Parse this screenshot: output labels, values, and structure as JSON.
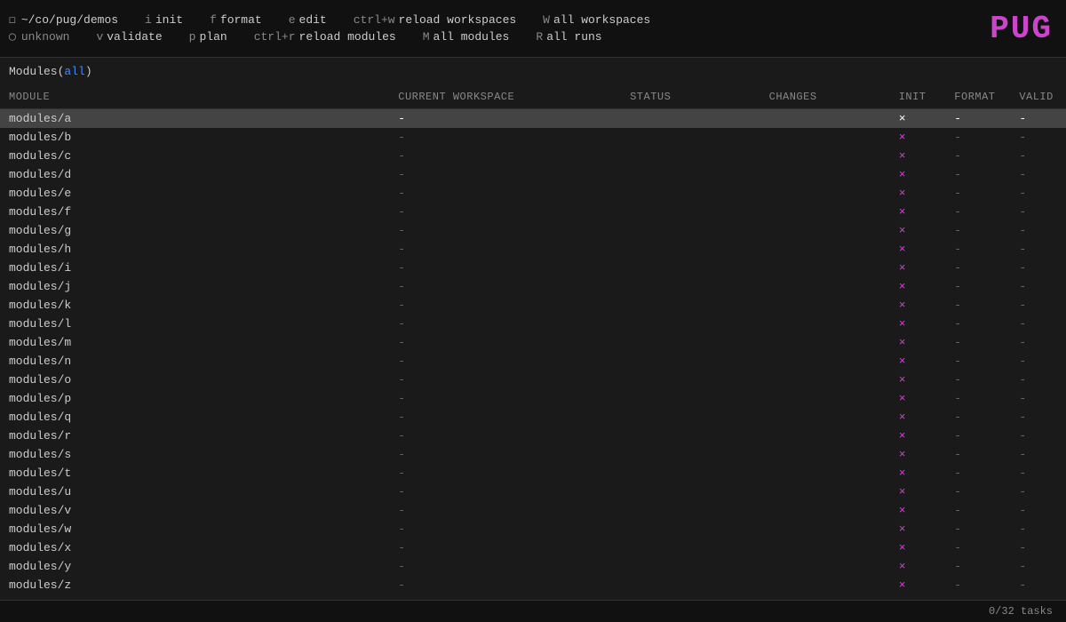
{
  "toolbar": {
    "path": "~/co/pug/demos",
    "path_icon": "⊙",
    "unknown_label": "unknown",
    "shortcuts": [
      {
        "key": "i",
        "label": "init"
      },
      {
        "key": "f",
        "label": "format"
      },
      {
        "key": "e",
        "label": "edit"
      },
      {
        "key": "ctrl+w",
        "label": "reload workspaces"
      },
      {
        "key": "W",
        "label": "all workspaces"
      }
    ],
    "shortcuts2": [
      {
        "key": "v",
        "label": "validate"
      },
      {
        "key": "p",
        "label": "plan"
      },
      {
        "key": "ctrl+r",
        "label": "reload modules"
      },
      {
        "key": "M",
        "label": "all modules"
      },
      {
        "key": "R",
        "label": "all runs"
      }
    ]
  },
  "logo": "PUG",
  "modules_title": "Modules",
  "modules_filter": "all",
  "table": {
    "headers": [
      "MODULE",
      "CURRENT WORKSPACE",
      "STATUS",
      "CHANGES",
      "INIT",
      "FORMAT",
      "VALID"
    ],
    "rows": [
      {
        "module": "modules/a",
        "workspace": "-",
        "status": "",
        "changes": "",
        "init": "×",
        "format": "-",
        "valid": "-",
        "selected": true
      },
      {
        "module": "modules/b",
        "workspace": "-",
        "status": "",
        "changes": "",
        "init": "×",
        "format": "-",
        "valid": "-"
      },
      {
        "module": "modules/c",
        "workspace": "-",
        "status": "",
        "changes": "",
        "init": "×",
        "format": "-",
        "valid": "-"
      },
      {
        "module": "modules/d",
        "workspace": "-",
        "status": "",
        "changes": "",
        "init": "×",
        "format": "-",
        "valid": "-"
      },
      {
        "module": "modules/e",
        "workspace": "-",
        "status": "",
        "changes": "",
        "init": "×",
        "format": "-",
        "valid": "-"
      },
      {
        "module": "modules/f",
        "workspace": "-",
        "status": "",
        "changes": "",
        "init": "×",
        "format": "-",
        "valid": "-"
      },
      {
        "module": "modules/g",
        "workspace": "-",
        "status": "",
        "changes": "",
        "init": "×",
        "format": "-",
        "valid": "-"
      },
      {
        "module": "modules/h",
        "workspace": "-",
        "status": "",
        "changes": "",
        "init": "×",
        "format": "-",
        "valid": "-"
      },
      {
        "module": "modules/i",
        "workspace": "-",
        "status": "",
        "changes": "",
        "init": "×",
        "format": "-",
        "valid": "-"
      },
      {
        "module": "modules/j",
        "workspace": "-",
        "status": "",
        "changes": "",
        "init": "×",
        "format": "-",
        "valid": "-"
      },
      {
        "module": "modules/k",
        "workspace": "-",
        "status": "",
        "changes": "",
        "init": "×",
        "format": "-",
        "valid": "-"
      },
      {
        "module": "modules/l",
        "workspace": "-",
        "status": "",
        "changes": "",
        "init": "×",
        "format": "-",
        "valid": "-"
      },
      {
        "module": "modules/m",
        "workspace": "-",
        "status": "",
        "changes": "",
        "init": "×",
        "format": "-",
        "valid": "-"
      },
      {
        "module": "modules/n",
        "workspace": "-",
        "status": "",
        "changes": "",
        "init": "×",
        "format": "-",
        "valid": "-"
      },
      {
        "module": "modules/o",
        "workspace": "-",
        "status": "",
        "changes": "",
        "init": "×",
        "format": "-",
        "valid": "-"
      },
      {
        "module": "modules/p",
        "workspace": "-",
        "status": "",
        "changes": "",
        "init": "×",
        "format": "-",
        "valid": "-"
      },
      {
        "module": "modules/q",
        "workspace": "-",
        "status": "",
        "changes": "",
        "init": "×",
        "format": "-",
        "valid": "-"
      },
      {
        "module": "modules/r",
        "workspace": "-",
        "status": "",
        "changes": "",
        "init": "×",
        "format": "-",
        "valid": "-"
      },
      {
        "module": "modules/s",
        "workspace": "-",
        "status": "",
        "changes": "",
        "init": "×",
        "format": "-",
        "valid": "-"
      },
      {
        "module": "modules/t",
        "workspace": "-",
        "status": "",
        "changes": "",
        "init": "×",
        "format": "-",
        "valid": "-"
      },
      {
        "module": "modules/u",
        "workspace": "-",
        "status": "",
        "changes": "",
        "init": "×",
        "format": "-",
        "valid": "-"
      },
      {
        "module": "modules/v",
        "workspace": "-",
        "status": "",
        "changes": "",
        "init": "×",
        "format": "-",
        "valid": "-"
      },
      {
        "module": "modules/w",
        "workspace": "-",
        "status": "",
        "changes": "",
        "init": "×",
        "format": "-",
        "valid": "-"
      },
      {
        "module": "modules/x",
        "workspace": "-",
        "status": "",
        "changes": "",
        "init": "×",
        "format": "-",
        "valid": "-"
      },
      {
        "module": "modules/y",
        "workspace": "-",
        "status": "",
        "changes": "",
        "init": "×",
        "format": "-",
        "valid": "-"
      },
      {
        "module": "modules/z",
        "workspace": "-",
        "status": "",
        "changes": "",
        "init": "×",
        "format": "-",
        "valid": "-"
      }
    ]
  },
  "statusbar": {
    "tasks": "0/32 tasks"
  }
}
